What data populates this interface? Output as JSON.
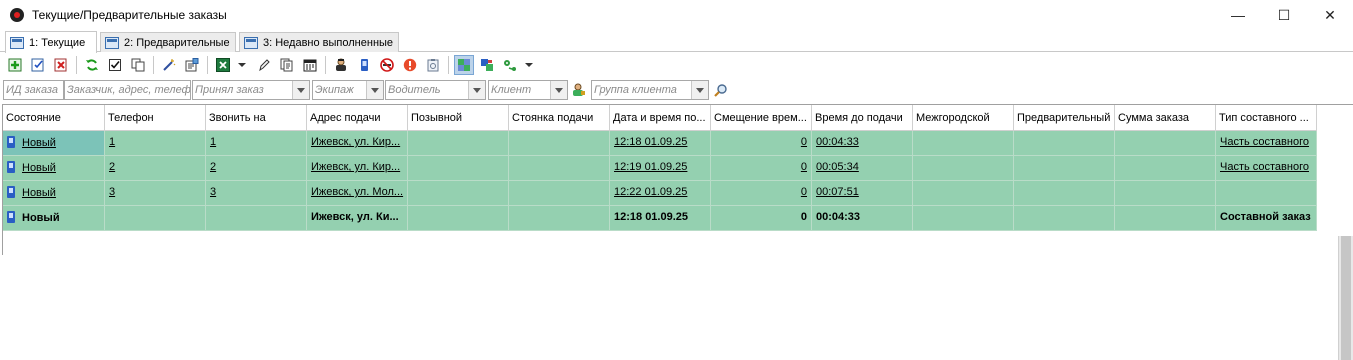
{
  "window": {
    "title": "Текущие/Предварительные заказы",
    "controls": {
      "minimize": "—",
      "maximize": "☐",
      "close": "✕"
    }
  },
  "tabs": [
    {
      "label": "1: Текущие",
      "active": true
    },
    {
      "label": "2: Предварительные",
      "active": false
    },
    {
      "label": "3: Недавно выполненные",
      "active": false
    }
  ],
  "toolbar": {
    "icons": [
      "add-order-icon",
      "edit-order-icon",
      "delete-order-icon",
      "refresh-icon",
      "check-icon",
      "copy-icon",
      "wand-icon",
      "properties-icon",
      "excel-export-icon",
      "pen-icon",
      "documents-icon",
      "calendar-icon",
      "driver-icon",
      "phone-icon",
      "no-smoking-icon",
      "alert-icon",
      "clipboard-icon",
      "grid-settings-icon",
      "group-icon",
      "route-icon"
    ]
  },
  "filters": {
    "order_id": "ИД заказа",
    "customer_address": "Заказчик, адрес, телефон",
    "accepted_by": "Принял заказ",
    "crew": "Экипаж",
    "driver": "Водитель",
    "client": "Клиент",
    "client_group": "Группа клиента"
  },
  "grid": {
    "columns": [
      "Состояние",
      "Телефон",
      "Звонить на",
      "Адрес подачи",
      "Позывной",
      "Стоянка подачи",
      "Дата и время по...",
      "Смещение врем...",
      "Время до подачи",
      "Межгородской",
      "Предварительный",
      "Сумма заказа",
      "Тип составного ..."
    ],
    "rows": [
      {
        "status": "Новый",
        "phone": "1",
        "call_to": "1",
        "address": "Ижевск, ул. Кир...",
        "callsign": "",
        "stand": "",
        "datetime": "12:18 01.09.25",
        "offset": "0",
        "time_to": "00:04:33",
        "intercity": "",
        "preliminary": "",
        "sum": "",
        "type": "Часть составного"
      },
      {
        "status": "Новый",
        "phone": "2",
        "call_to": "2",
        "address": "Ижевск, ул. Кир...",
        "callsign": "",
        "stand": "",
        "datetime": "12:19 01.09.25",
        "offset": "0",
        "time_to": "00:05:34",
        "intercity": "",
        "preliminary": "",
        "sum": "",
        "type": "Часть составного"
      },
      {
        "status": "Новый",
        "phone": "3",
        "call_to": "3",
        "address": "Ижевск, ул. Мол...",
        "callsign": "",
        "stand": "",
        "datetime": "12:22 01.09.25",
        "offset": "0",
        "time_to": "00:07:51",
        "intercity": "",
        "preliminary": "",
        "sum": "",
        "type": ""
      },
      {
        "status": "Новый",
        "phone": "",
        "call_to": "",
        "address": "Ижевск, ул. Ки...",
        "callsign": "",
        "stand": "",
        "datetime": "12:18 01.09.25",
        "offset": "0",
        "time_to": "00:04:33",
        "intercity": "",
        "preliminary": "",
        "sum": "",
        "type": "Составной заказ"
      }
    ],
    "row_color": "#94d0b0",
    "selected_color": "#7cc3b8"
  }
}
